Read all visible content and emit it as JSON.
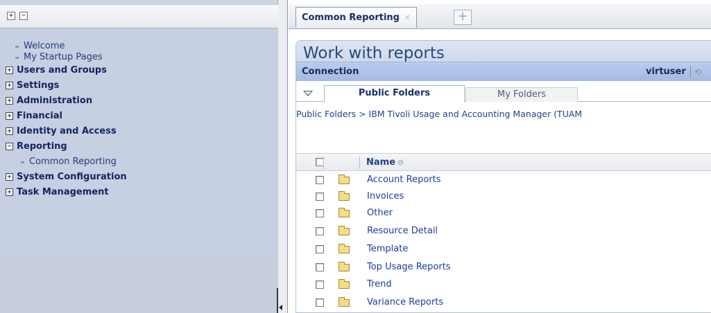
{
  "nav": {
    "toolbar": {
      "expand_glyph": "+",
      "collapse_glyph": "−"
    },
    "items": [
      {
        "label": "Welcome",
        "kind": "link"
      },
      {
        "label": "My Startup Pages",
        "kind": "link"
      },
      {
        "label": "Users and Groups",
        "kind": "category",
        "expanded": false
      },
      {
        "label": "Settings",
        "kind": "category",
        "expanded": false
      },
      {
        "label": "Administration",
        "kind": "category",
        "expanded": false
      },
      {
        "label": "Financial",
        "kind": "category",
        "expanded": false
      },
      {
        "label": "Identity and Access",
        "kind": "category",
        "expanded": false
      },
      {
        "label": "Reporting",
        "kind": "category",
        "expanded": true
      },
      {
        "label": "Common Reporting",
        "kind": "sublink"
      },
      {
        "label": "System Configuration",
        "kind": "category",
        "expanded": false
      },
      {
        "label": "Task Management",
        "kind": "category",
        "expanded": false
      }
    ],
    "expand_glyph": "+",
    "collapse_glyph": "−"
  },
  "tabs": {
    "active": {
      "label": "Common Reporting",
      "close_glyph": "×"
    },
    "add_glyph": "+"
  },
  "panel": {
    "title": "Work with reports",
    "connection_label": "Connection",
    "user": "virtuser",
    "folder_tabs": {
      "public": "Public Folders",
      "my": "My Folders"
    },
    "breadcrumb": "Public Folders > IBM Tivoli Usage and Accounting Manager (TUAM",
    "list": {
      "name_header": "Name",
      "sort_glyph": "⊖",
      "rows": [
        "Account Reports",
        "Invoices",
        "Other",
        "Resource Detail",
        "Template",
        "Top Usage Reports",
        "Trend",
        "Variance Reports"
      ]
    }
  },
  "colors": {
    "nav_background": "#c6d0e2",
    "connection_bar": "#a3bbe2",
    "link": "#1e3d99",
    "title": "#264a7a"
  }
}
